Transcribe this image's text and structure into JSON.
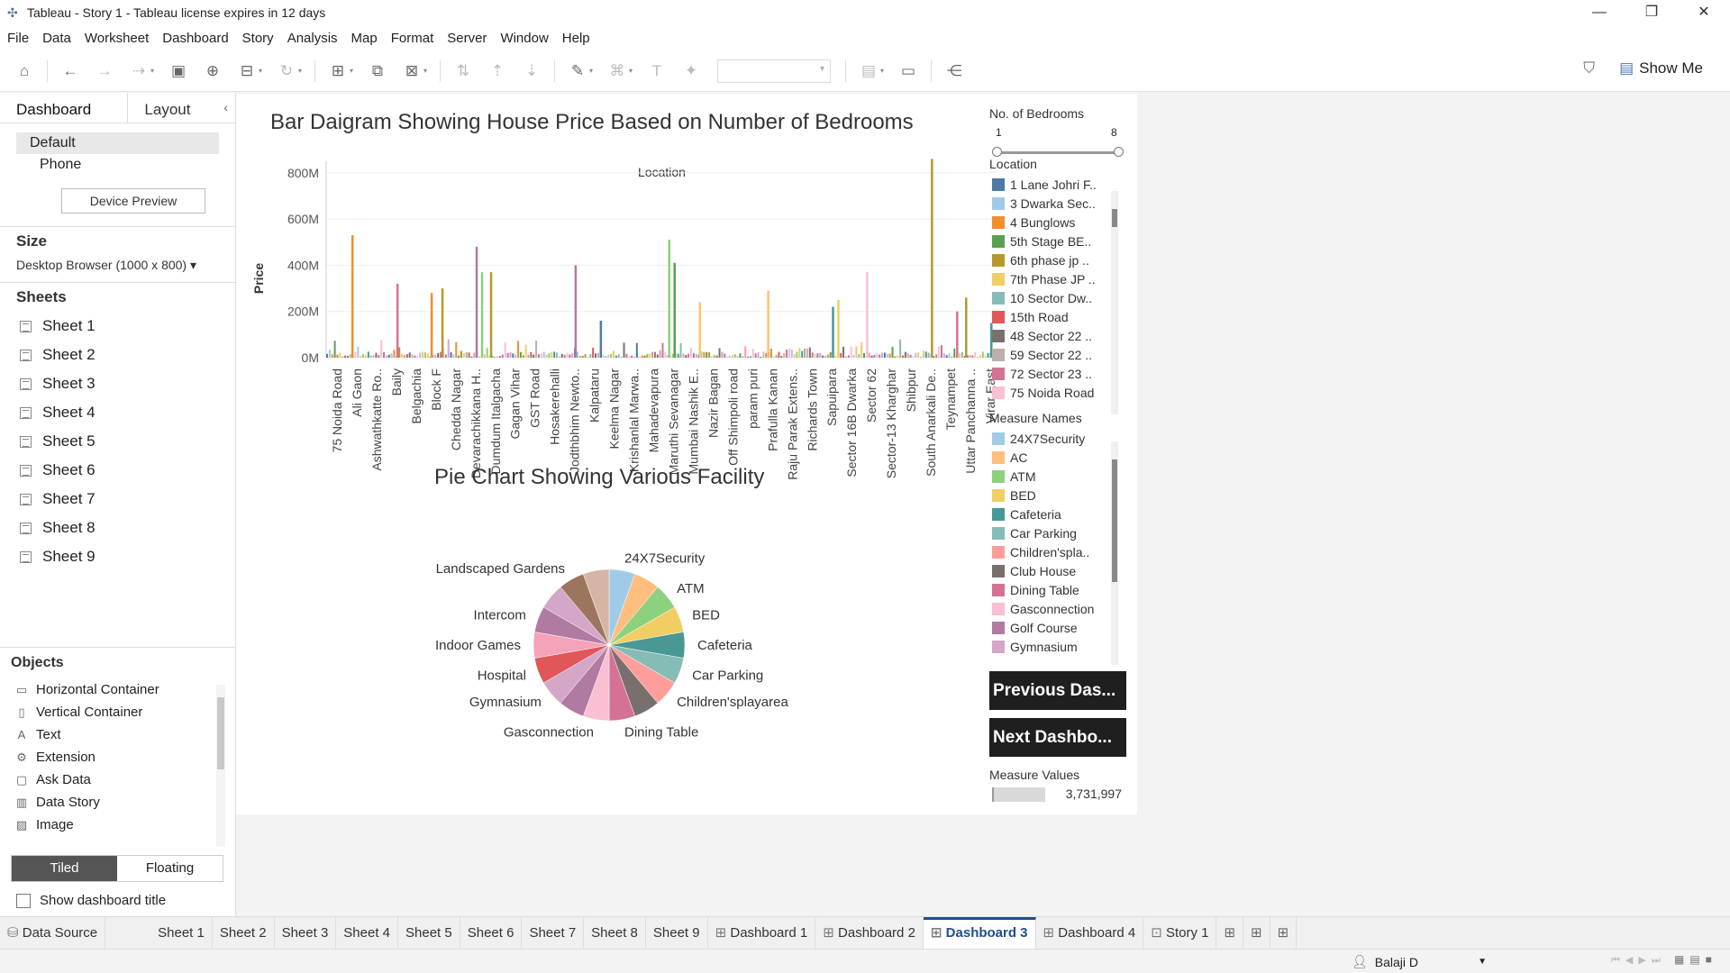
{
  "window": {
    "title": "Tableau - Story 1 - Tableau license expires in 12 days",
    "controls": [
      "—",
      "❐",
      "✕"
    ]
  },
  "menu": [
    "File",
    "Data",
    "Worksheet",
    "Dashboard",
    "Story",
    "Analysis",
    "Map",
    "Format",
    "Server",
    "Window",
    "Help"
  ],
  "toolbar": {
    "show_me": "Show Me"
  },
  "left_panel": {
    "tabs": [
      "Dashboard",
      "Layout"
    ],
    "devices": [
      "Default",
      "Phone"
    ],
    "device_preview": "Device Preview",
    "size_title": "Size",
    "size_value": "Desktop Browser (1000 x 800) ▾",
    "sheets_title": "Sheets",
    "sheets": [
      "Sheet 1",
      "Sheet 2",
      "Sheet 3",
      "Sheet 4",
      "Sheet 5",
      "Sheet 6",
      "Sheet 7",
      "Sheet 8",
      "Sheet 9"
    ],
    "objects_title": "Objects",
    "objects": [
      {
        "label": "Horizontal Container",
        "icon": "horizontal-container-icon"
      },
      {
        "label": "Vertical Container",
        "icon": "vertical-container-icon"
      },
      {
        "label": "Text",
        "icon": "text-icon"
      },
      {
        "label": "Extension",
        "icon": "extension-icon"
      },
      {
        "label": "Ask Data",
        "icon": "ask-data-icon"
      },
      {
        "label": "Data Story",
        "icon": "data-story-icon"
      },
      {
        "label": "Image",
        "icon": "image-icon"
      }
    ],
    "layout_modes": [
      "Tiled",
      "Floating"
    ],
    "show_dashboard_title": "Show dashboard title"
  },
  "dashboard": {
    "bar_title": "Bar Daigram Showing House Price Based on Number of Bedrooms",
    "pie_title": "Pie Chart Showing Various Facility",
    "filter_title": "No. of Bedrooms",
    "filter_min": "1",
    "filter_max": "8",
    "location_title": "Location",
    "locations": [
      {
        "name": "1 Lane Johri F..",
        "color": "#4e79a7"
      },
      {
        "name": "3 Dwarka Sec..",
        "color": "#a0cbe8"
      },
      {
        "name": "4 Bunglows",
        "color": "#f28e2b"
      },
      {
        "name": "5th Stage BE..",
        "color": "#59a14f"
      },
      {
        "name": "6th phase jp ..",
        "color": "#b6992d"
      },
      {
        "name": "7th Phase JP ..",
        "color": "#f1ce63"
      },
      {
        "name": "10 Sector Dw..",
        "color": "#86bcb6"
      },
      {
        "name": "15th Road",
        "color": "#e15759"
      },
      {
        "name": "48 Sector 22 ..",
        "color": "#79706e"
      },
      {
        "name": "59 Sector 22 ..",
        "color": "#bab0ac"
      },
      {
        "name": "72 Sector 23 ..",
        "color": "#d37295"
      },
      {
        "name": "75 Noida Road",
        "color": "#fabfd2"
      }
    ],
    "measure_names_title": "Measure Names",
    "measure_names": [
      {
        "name": "24X7Security",
        "color": "#a0cbe8"
      },
      {
        "name": "AC",
        "color": "#ffbe7d"
      },
      {
        "name": "ATM",
        "color": "#8cd17d"
      },
      {
        "name": "BED",
        "color": "#f1ce63"
      },
      {
        "name": "Cafeteria",
        "color": "#499894"
      },
      {
        "name": "Car Parking",
        "color": "#86bcb6"
      },
      {
        "name": "Children'spla..",
        "color": "#ff9d9a"
      },
      {
        "name": "Club House",
        "color": "#79706e"
      },
      {
        "name": "Dining Table",
        "color": "#d37295"
      },
      {
        "name": "Gasconnection",
        "color": "#fabfd2"
      },
      {
        "name": "Golf Course",
        "color": "#b07aa1"
      },
      {
        "name": "Gymnasium",
        "color": "#d4a6c8"
      }
    ],
    "prev_button": "Previous Das...",
    "next_button": "Next Dashbo...",
    "measure_values_title": "Measure Values",
    "measure_values_value": "3,731,997",
    "measure_values_fill": 0.4
  },
  "chart_data": [
    {
      "type": "bar",
      "title": "Bar Daigram Showing House Price Based on Number of Bedrooms",
      "column_header": "Location",
      "ylabel": "Price",
      "yticks": [
        "800M",
        "600M",
        "400M",
        "200M",
        "0M"
      ],
      "ylim": [
        0,
        850
      ],
      "unit": "M",
      "categories": [
        "75 Noida Road",
        "Ali Gaon",
        "Ashwathkatte Ro..",
        "Baily",
        "Belgachia",
        "Block F",
        "Chedda Nagar",
        "Devarachikkana H..",
        "Dumdum Italgacha",
        "Gagan Vihar",
        "GST Road",
        "Hosakerehalli",
        "Jodthbhim Newto..",
        "Kalpataru",
        "Keelma Nagar",
        "Krishanlal Marwa..",
        "Mahadevapura",
        "Maruthi Sevanagar",
        "Mumbai Nashik E..",
        "Nazir Bagan",
        "Off Shimpoli road",
        "param puri",
        "Prafulla Kanan",
        "Raju Parak Extens..",
        "Richards Town",
        "Sapuipara",
        "Sector 16B Dwarka",
        "Sector 62",
        "Sector-13 Kharghar",
        "Shibpur",
        "South Anarkali De..",
        "Teynampet",
        "Uttar Panchanna ..",
        "Virar East"
      ],
      "tall_bars": [
        {
          "near": "Ali Gaon",
          "value": 530,
          "color": "#f28e2b"
        },
        {
          "near": "Baily",
          "value": 320,
          "color": "#d37295"
        },
        {
          "near": "Block F",
          "value": 300,
          "color": "#b6992d"
        },
        {
          "near": "Block F",
          "value": 280,
          "color": "#f28e2b"
        },
        {
          "near": "Devarachikkana H..",
          "value": 480,
          "color": "#b07aa1"
        },
        {
          "near": "Devarachikkana H..",
          "value": 370,
          "color": "#8cd17d"
        },
        {
          "near": "Dumdum Italgacha",
          "value": 370,
          "color": "#b6992d"
        },
        {
          "near": "Jodthbhim Newto..",
          "value": 400,
          "color": "#b07aa1"
        },
        {
          "near": "Kalpataru",
          "value": 160,
          "color": "#4e79a7"
        },
        {
          "near": "Maruthi Sevanagar",
          "value": 510,
          "color": "#8cd17d"
        },
        {
          "near": "Maruthi Sevanagar",
          "value": 410,
          "color": "#59a14f"
        },
        {
          "near": "Mumbai Nashik E..",
          "value": 240,
          "color": "#f1ce63"
        },
        {
          "near": "Prafulla Kanan",
          "value": 290,
          "color": "#ffbe7d"
        },
        {
          "near": "Sapuipara",
          "value": 220,
          "color": "#499894"
        },
        {
          "near": "Sapuipara",
          "value": 250,
          "color": "#f1ce63"
        },
        {
          "near": "Sector 62",
          "value": 370,
          "color": "#fabfd2"
        },
        {
          "near": "South Anarkali De..",
          "value": 860,
          "color": "#b6992d"
        },
        {
          "near": "Teynampet",
          "value": 200,
          "color": "#d37295"
        },
        {
          "near": "Uttar Panchanna ..",
          "value": 260,
          "color": "#b6992d"
        },
        {
          "near": "Virar East",
          "value": 150,
          "color": "#499894"
        }
      ]
    },
    {
      "type": "pie",
      "title": "Pie Chart Showing Various Facility",
      "slices": [
        {
          "label": "24X7Security",
          "value": 1,
          "color": "#a0cbe8"
        },
        {
          "label": "",
          "value": 1,
          "color": "#ffbe7d"
        },
        {
          "label": "ATM",
          "value": 1,
          "color": "#8cd17d"
        },
        {
          "label": "BED",
          "value": 1,
          "color": "#f1ce63"
        },
        {
          "label": "Cafeteria",
          "value": 1,
          "color": "#499894"
        },
        {
          "label": "Car Parking",
          "value": 1,
          "color": "#86bcb6"
        },
        {
          "label": "Children'splayarea",
          "value": 1,
          "color": "#ff9d9a"
        },
        {
          "label": "",
          "value": 1,
          "color": "#79706e"
        },
        {
          "label": "Dining Table",
          "value": 1,
          "color": "#d37295"
        },
        {
          "label": "Gasconnection",
          "value": 1,
          "color": "#fabfd2"
        },
        {
          "label": "",
          "value": 1,
          "color": "#b07aa1"
        },
        {
          "label": "Gymnasium",
          "value": 1,
          "color": "#d4a6c8"
        },
        {
          "label": "Hospital",
          "value": 1,
          "color": "#e15759"
        },
        {
          "label": "Indoor Games",
          "value": 1,
          "color": "#f4a3b8"
        },
        {
          "label": "Intercom",
          "value": 1,
          "color": "#b07aa1"
        },
        {
          "label": "",
          "value": 1,
          "color": "#d4a6c8"
        },
        {
          "label": "Landscaped Gardens",
          "value": 1,
          "color": "#9c755f"
        },
        {
          "label": "",
          "value": 1,
          "color": "#d7b5a6"
        }
      ]
    }
  ],
  "bottom_tabs": [
    {
      "label": "Data Source",
      "icon": "database-icon"
    },
    {
      "label": "Sheet 1"
    },
    {
      "label": "Sheet 2"
    },
    {
      "label": "Sheet 3"
    },
    {
      "label": "Sheet 4"
    },
    {
      "label": "Sheet 5"
    },
    {
      "label": "Sheet 6"
    },
    {
      "label": "Sheet 7"
    },
    {
      "label": "Sheet 8"
    },
    {
      "label": "Sheet 9"
    },
    {
      "label": "Dashboard 1",
      "icon": "dashboard-icon"
    },
    {
      "label": "Dashboard 2",
      "icon": "dashboard-icon"
    },
    {
      "label": "Dashboard 3",
      "icon": "dashboard-icon",
      "active": true
    },
    {
      "label": "Dashboard 4",
      "icon": "dashboard-icon"
    },
    {
      "label": "Story 1",
      "icon": "story-icon"
    }
  ],
  "status": {
    "user": "Balaji D"
  }
}
